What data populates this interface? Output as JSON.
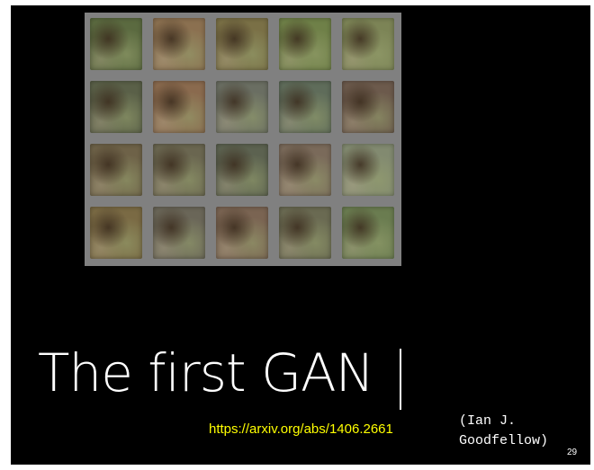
{
  "slide": {
    "title": "The first GAN",
    "link": "https://arxiv.org/abs/1406.2661",
    "author": "(Ian J.\nGoodfellow)",
    "page_number": "29"
  },
  "samples": {
    "rows": 4,
    "cols": 5,
    "tile_colors": [
      [
        "#5b6a40",
        "#8b7050",
        "#7a7046",
        "#6f8048",
        "#7c8456"
      ],
      [
        "#5a6048",
        "#8a6a4e",
        "#6a6e62",
        "#5f6c5a",
        "#6c5a4c"
      ],
      [
        "#6e6248",
        "#6a6650",
        "#5c6250",
        "#7a6a5a",
        "#828a70"
      ],
      [
        "#7a6a44",
        "#6a6658",
        "#7a6452",
        "#6a6a52",
        "#6a7c50"
      ]
    ]
  },
  "colors": {
    "background": "#000000",
    "panel": "#808080",
    "title": "#ffffff",
    "link": "#ffff00"
  }
}
